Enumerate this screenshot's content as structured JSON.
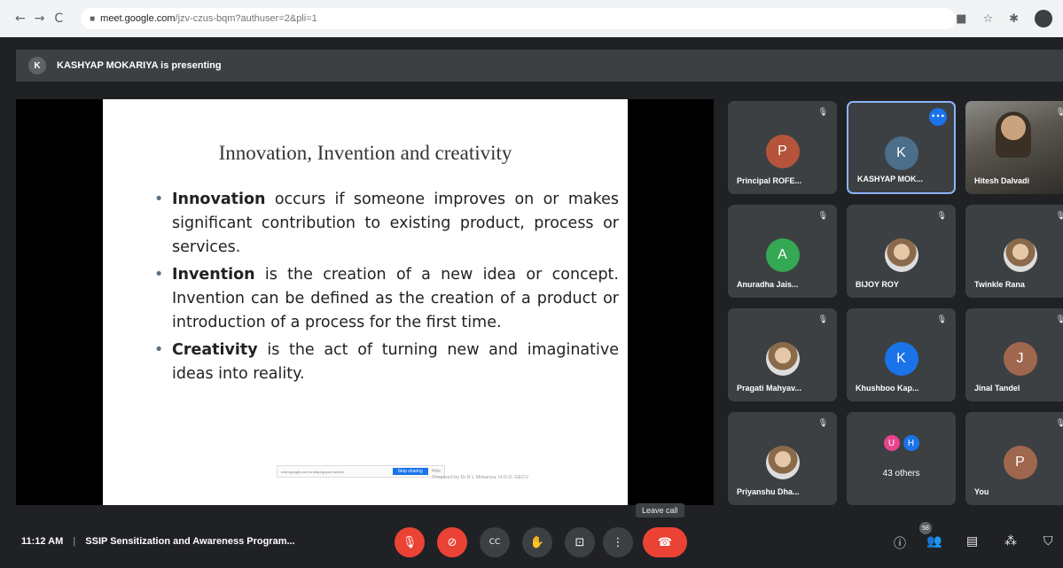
{
  "browser": {
    "back": "←",
    "forward": "→",
    "reload": "C",
    "url_host": "meet.google.com",
    "url_path": "/jzv-czus-bqm?authuser=2&pli=1"
  },
  "presenting": {
    "initial": "K",
    "text": "KASHYAP MOKARIYA is presenting"
  },
  "slide": {
    "title": "Innovation, Invention and creativity",
    "bullets": [
      {
        "term": "Innovation",
        "text": " occurs if someone improves on or makes significant contribution to existing product, process or services."
      },
      {
        "term": "Invention",
        "text": " is the creation of a new idea or concept. Invention can be defined as the creation of a product or introduction of a process for the first time."
      },
      {
        "term": "Creativity",
        "text": " is the act of turning new and imaginative ideas into reality."
      }
    ],
    "share_notice": "meet.google.com is sharing your screen.",
    "stop_sharing": "Stop sharing",
    "hide": "Hide",
    "footer": "Prepared by Dr R L Mokariya, H.O.D. GECV"
  },
  "participants": [
    {
      "name": "Principal ROFE...",
      "initial": "P",
      "color": "#b5543a",
      "type": "initial",
      "muted": true
    },
    {
      "name": "KASHYAP MOK...",
      "initial": "K",
      "color": "#4b6e8a",
      "type": "initial",
      "muted": false,
      "active": true
    },
    {
      "name": "Hitesh Dalvadi",
      "initial": "",
      "color": "",
      "type": "video",
      "muted": true
    },
    {
      "name": "Anuradha Jais...",
      "initial": "A",
      "color": "#34a853",
      "type": "initial",
      "muted": true
    },
    {
      "name": "BIJOY ROY",
      "initial": "",
      "color": "",
      "type": "photo",
      "muted": true
    },
    {
      "name": "Twinkle Rana",
      "initial": "",
      "color": "",
      "type": "photo",
      "muted": true
    },
    {
      "name": "Pragati Mahyav...",
      "initial": "",
      "color": "",
      "type": "photo",
      "muted": true
    },
    {
      "name": "Khushboo Kap...",
      "initial": "K",
      "color": "#1a73e8",
      "type": "initial",
      "muted": true
    },
    {
      "name": "Jinal Tandel",
      "initial": "J",
      "color": "#a0674f",
      "type": "initial",
      "muted": true
    },
    {
      "name": "Priyanshu Dha...",
      "initial": "",
      "color": "",
      "type": "photo",
      "muted": true
    },
    {
      "name": "",
      "initial": "",
      "color": "",
      "type": "others",
      "muted": false,
      "others_label": "43 others",
      "others_initials": [
        "U",
        "H"
      ],
      "others_colors": [
        "#e8448b",
        "#1a73e8"
      ]
    },
    {
      "name": "You",
      "initial": "P",
      "color": "#a0674f",
      "type": "initial",
      "muted": true
    }
  ],
  "bottom": {
    "time": "11:12 AM",
    "separator": "|",
    "meeting_title": "SSIP Sensitization and Awareness Program...",
    "leave_tooltip": "Leave call",
    "people_count": "58"
  },
  "icons": {
    "mic_off": "🎙",
    "cam_off": "⊘",
    "captions": "CC",
    "raise_hand": "✋",
    "present": "⊡",
    "more": "⋮",
    "leave": "☎",
    "info": "ⓘ",
    "people": "👥",
    "chat": "▤",
    "activities": "⁂",
    "host": "⛉"
  }
}
